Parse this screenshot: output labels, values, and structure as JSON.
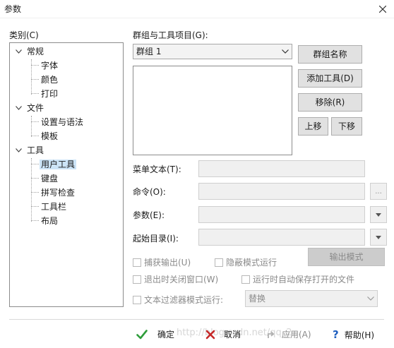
{
  "window": {
    "title": "参数"
  },
  "category": {
    "label": "类别(C)",
    "tree": [
      {
        "label": "常规",
        "children": [
          "字体",
          "颜色",
          "打印"
        ]
      },
      {
        "label": "文件",
        "children": [
          "设置与语法",
          "模板"
        ]
      },
      {
        "label": "工具",
        "children": [
          "用户工具",
          "键盘",
          "拼写检查",
          "工具栏",
          "布局"
        ]
      }
    ],
    "selected": "用户工具"
  },
  "groups": {
    "label": "群组与工具项目(G):",
    "selected_group": "群组 1",
    "buttons": {
      "group_name": "群组名称",
      "add_tool": "添加工具(D)",
      "remove": "移除(R)",
      "up": "上移",
      "down": "下移"
    }
  },
  "form": {
    "menu_text_label": "菜单文本(T):",
    "command_label": "命令(O):",
    "browse_label": "...",
    "args_label": "参数(E):",
    "start_dir_label": "起始目录(I):",
    "output_pattern_button": "输出模式"
  },
  "options": {
    "capture_output": "捕获输出(U)",
    "hidden_mode": "隐蔽模式运行",
    "close_on_exit": "退出时关闭窗口(W)",
    "autosave": "运行时自动保存打开的文件",
    "text_filter": "文本过滤器模式运行:",
    "filter_mode": "替换"
  },
  "footer": {
    "ok": "确定",
    "cancel": "取消",
    "apply": "应用(A)",
    "help": "帮助(H)",
    "watermark": "http://blog.csdn.net/qq_2..."
  },
  "colors": {
    "ok_green": "#2e9d3a",
    "cancel_red": "#c62828",
    "help_blue": "#1f5fbf",
    "selection": "#cce4f7"
  }
}
